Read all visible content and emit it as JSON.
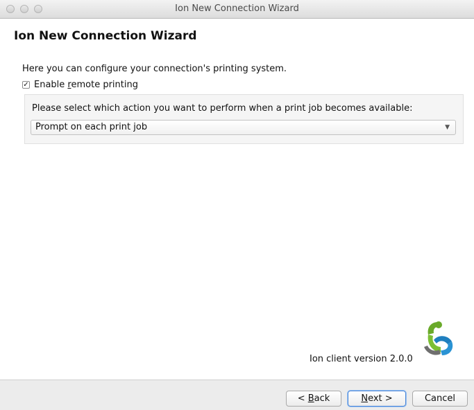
{
  "window": {
    "title": "Ion New Connection Wizard"
  },
  "wizard": {
    "title": "Ion New Connection Wizard",
    "description": "Here you can configure your connection's printing system.",
    "enable_remote_printing": {
      "label_pre": "Enable ",
      "label_mnemonic": "r",
      "label_post": "emote printing",
      "checked": true,
      "check_glyph": "✓"
    },
    "action_group": {
      "label": "Please select which action you want to perform when a print job becomes available:",
      "select_value": "Prompt on each print job"
    },
    "version": "Ion client version 2.0.0"
  },
  "buttons": {
    "back": {
      "pre": "< ",
      "mnemonic": "B",
      "post": "ack"
    },
    "next": {
      "mnemonic": "N",
      "post": "ext >"
    },
    "cancel": "Cancel"
  },
  "icons": {
    "select_arrow": "chevron-down-icon",
    "logo": "ion-logo-icon"
  },
  "colors": {
    "logo_green": "#6aaa2a",
    "logo_blue": "#1f7fbf",
    "logo_gray": "#6f6f6f",
    "default_button_ring": "#4a86d8"
  }
}
